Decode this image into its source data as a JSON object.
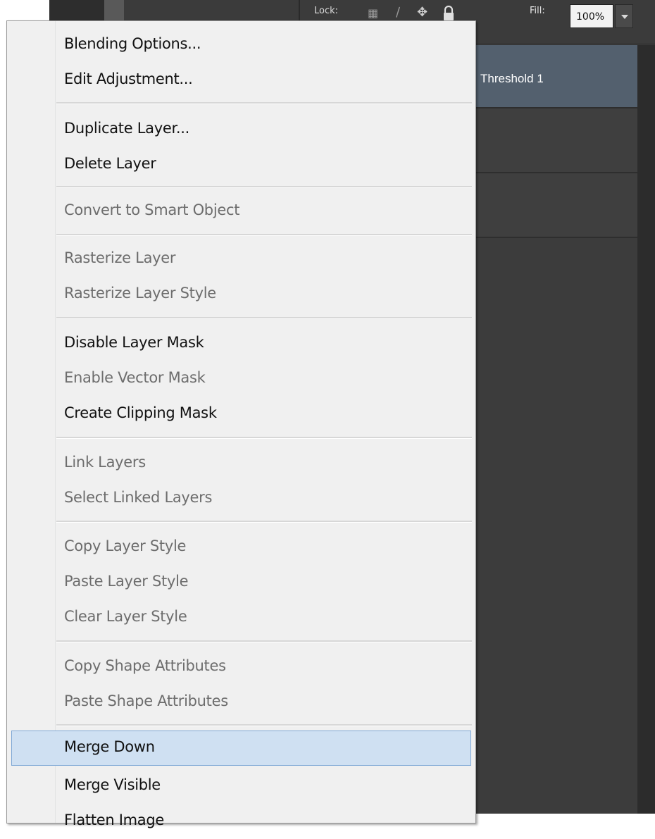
{
  "layers_panel": {
    "lock_label": "Lock:",
    "fill_label": "Fill:",
    "fill_value": "100%",
    "layers": [
      {
        "name": "Threshold 1",
        "selected": true
      },
      {
        "name": "",
        "selected": false
      },
      {
        "name": "",
        "selected": false
      }
    ]
  },
  "context_menu": {
    "items": [
      {
        "label": "Blending Options...",
        "enabled": true
      },
      {
        "label": "Edit Adjustment...",
        "enabled": true
      },
      {
        "label": "Duplicate Layer...",
        "enabled": true
      },
      {
        "label": "Delete Layer",
        "enabled": true
      },
      {
        "label": "Convert to Smart Object",
        "enabled": false
      },
      {
        "label": "Rasterize Layer",
        "enabled": false
      },
      {
        "label": "Rasterize Layer Style",
        "enabled": false
      },
      {
        "label": "Disable Layer Mask",
        "enabled": true
      },
      {
        "label": "Enable Vector Mask",
        "enabled": false
      },
      {
        "label": "Create Clipping Mask",
        "enabled": true
      },
      {
        "label": "Link Layers",
        "enabled": false
      },
      {
        "label": "Select Linked Layers",
        "enabled": false
      },
      {
        "label": "Copy Layer Style",
        "enabled": false
      },
      {
        "label": "Paste Layer Style",
        "enabled": false
      },
      {
        "label": "Clear Layer Style",
        "enabled": false
      },
      {
        "label": "Copy Shape Attributes",
        "enabled": false
      },
      {
        "label": "Paste Shape Attributes",
        "enabled": false
      },
      {
        "label": "Merge Down",
        "enabled": true,
        "highlighted": true
      },
      {
        "label": "Merge Visible",
        "enabled": true
      },
      {
        "label": "Flatten Image",
        "enabled": true
      }
    ]
  },
  "colors": {
    "menu_background": "#f0f0f0",
    "highlight_background": "#cfe0f2",
    "highlight_border": "#7fa8d6",
    "selected_layer": "#53606e",
    "panel_background": "#3c3c3c"
  }
}
